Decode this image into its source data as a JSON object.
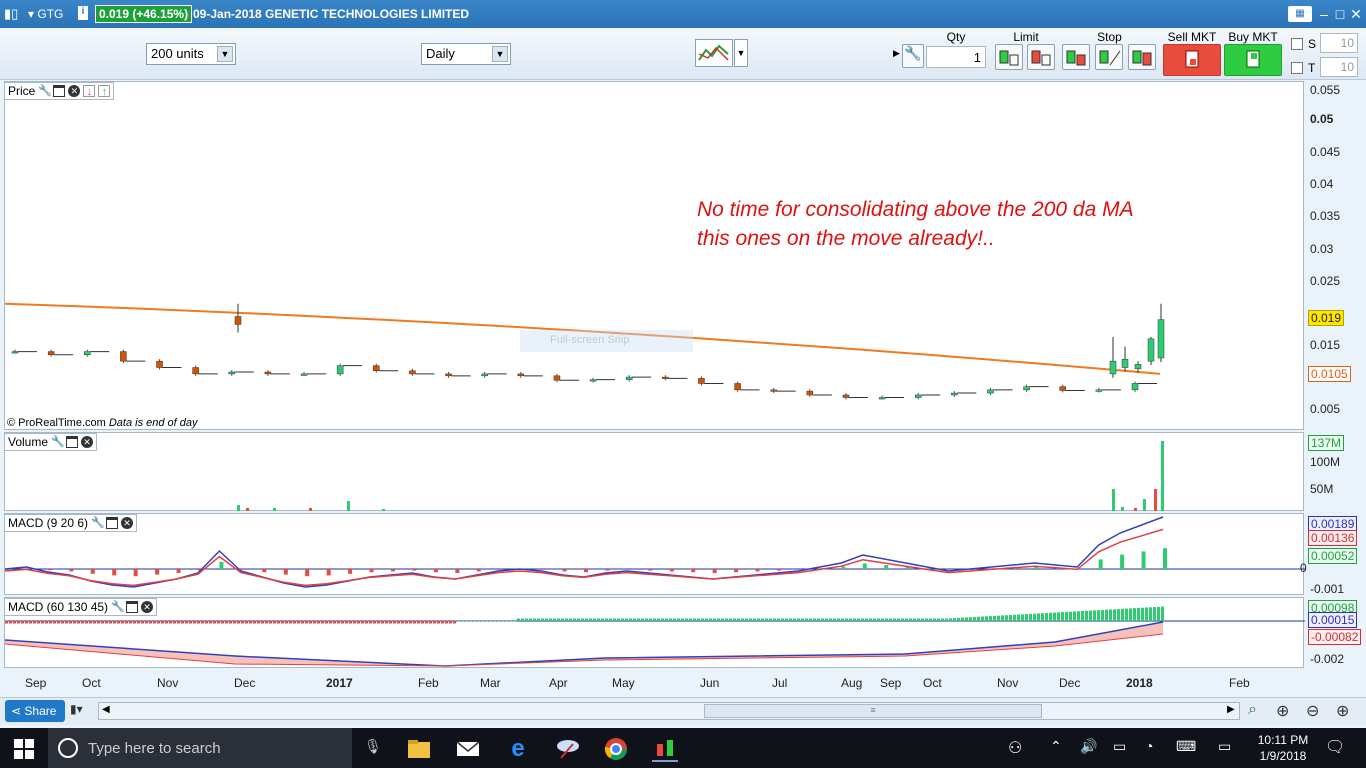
{
  "titlebar": {
    "symbol": "GTG",
    "change": "0.019 (+46.15%)",
    "name": "09-Jan-2018 GENETIC TECHNOLOGIES LIMITED"
  },
  "toolbar": {
    "units": "200 units",
    "period": "Daily",
    "qty_label": "Qty",
    "qty_value": "1",
    "limit_label": "Limit",
    "stop_label": "Stop",
    "sell_label": "Sell MKT",
    "buy_label": "Buy MKT",
    "s_label": "S",
    "t_label": "T",
    "s_value": "10",
    "t_value": "10"
  },
  "price_panel": {
    "label": "Price",
    "copyright": "© ProRealTime.com",
    "data_note": "Data is end of day",
    "annotation_line1": "No time for consolidating above the 200 da MA",
    "annotation_line2": "this ones on the move already!..",
    "snip_ghost": "Full-screen Snip",
    "y_ticks": [
      "0.055",
      "0.05",
      "0.045",
      "0.04",
      "0.035",
      "0.03",
      "0.025",
      "0.015",
      "0.005"
    ],
    "price_tag": "0.019",
    "ma_tag": "0.0105"
  },
  "volume_panel": {
    "label": "Volume",
    "y_ticks": [
      "100M",
      "50M"
    ],
    "vol_tag": "137M"
  },
  "macd1_panel": {
    "label": "MACD (9 20 6)",
    "y_ticks": [
      "0",
      "-0.001"
    ],
    "tag1": "0.00189",
    "tag2": "0.00136",
    "tag3": "0.00052"
  },
  "macd2_panel": {
    "label": "MACD (60 130 45)",
    "y_ticks": [
      "-0.002"
    ],
    "tag1": "0.00098",
    "tag2": "0.00015",
    "tag3": "-0.00082"
  },
  "x_axis": [
    "Sep",
    "Oct",
    "Nov",
    "Dec",
    "2017",
    "Feb",
    "Mar",
    "Apr",
    "May",
    "Jun",
    "Jul",
    "Aug",
    "Sep",
    "Oct",
    "Nov",
    "Dec",
    "2018",
    "Feb"
  ],
  "bottombar": {
    "share_label": "Share"
  },
  "taskbar": {
    "search_placeholder": "Type here to search",
    "time": "10:11 PM",
    "date": "1/9/2018"
  },
  "colors": {
    "ma_line": "#f07a20",
    "up_candle": "#2ecc71",
    "down_candle": "#d35400",
    "annotation": "#e01010"
  },
  "chart_data": {
    "type": "candlestick",
    "moving_average": {
      "period": 200,
      "start": 0.0215,
      "end": 0.0105
    },
    "prices_close": [
      0.014,
      0.0135,
      0.014,
      0.0125,
      0.0115,
      0.0105,
      0.0108,
      0.0105,
      0.0105,
      0.0118,
      0.011,
      0.0105,
      0.0102,
      0.0105,
      0.0102,
      0.0095,
      0.0096,
      0.01,
      0.0098,
      0.009,
      0.008,
      0.0078,
      0.0072,
      0.0068,
      0.0068,
      0.0072,
      0.0075,
      0.008,
      0.0085,
      0.0079,
      0.008,
      0.009,
      0.0125,
      0.0117,
      0.013,
      0.019
    ]
  }
}
